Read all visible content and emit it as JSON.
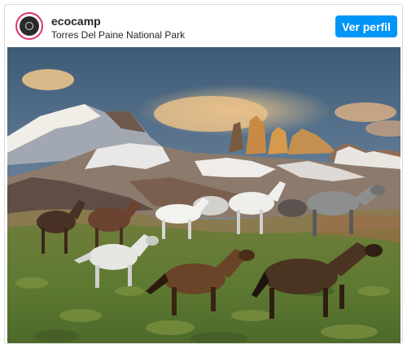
{
  "post": {
    "username": "ecocamp",
    "location": "Torres Del Paine National Park",
    "follow_button_label": "Ver perfil",
    "avatar_icon": "ecocamp-logo",
    "photo": "horses-running-torres-del-paine"
  },
  "colors": {
    "button": "#0095f6",
    "avatar_ring": "#e1306c",
    "border": "#dbdbdb",
    "text": "#262626"
  }
}
